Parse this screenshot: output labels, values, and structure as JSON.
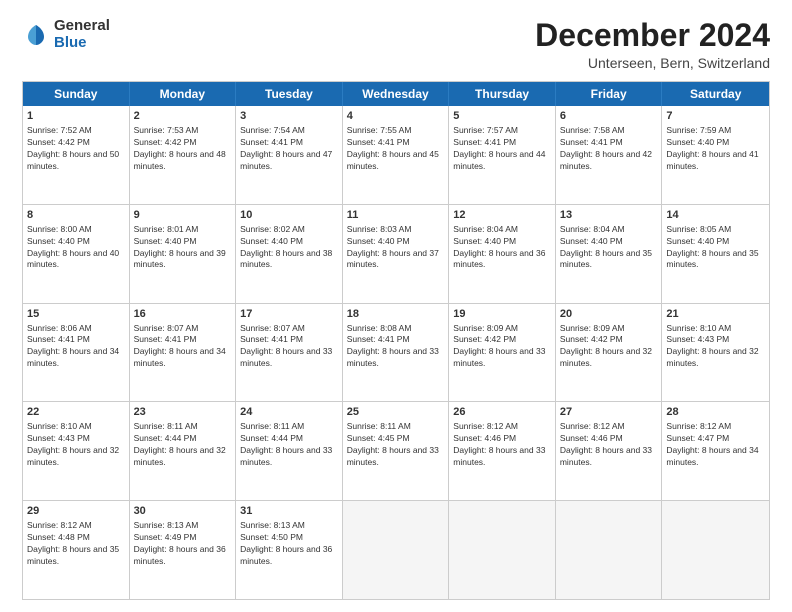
{
  "logo": {
    "general": "General",
    "blue": "Blue"
  },
  "title": "December 2024",
  "subtitle": "Unterseen, Bern, Switzerland",
  "days": [
    "Sunday",
    "Monday",
    "Tuesday",
    "Wednesday",
    "Thursday",
    "Friday",
    "Saturday"
  ],
  "weeks": [
    [
      {
        "day": "1",
        "sunrise": "Sunrise: 7:52 AM",
        "sunset": "Sunset: 4:42 PM",
        "daylight": "Daylight: 8 hours and 50 minutes."
      },
      {
        "day": "2",
        "sunrise": "Sunrise: 7:53 AM",
        "sunset": "Sunset: 4:42 PM",
        "daylight": "Daylight: 8 hours and 48 minutes."
      },
      {
        "day": "3",
        "sunrise": "Sunrise: 7:54 AM",
        "sunset": "Sunset: 4:41 PM",
        "daylight": "Daylight: 8 hours and 47 minutes."
      },
      {
        "day": "4",
        "sunrise": "Sunrise: 7:55 AM",
        "sunset": "Sunset: 4:41 PM",
        "daylight": "Daylight: 8 hours and 45 minutes."
      },
      {
        "day": "5",
        "sunrise": "Sunrise: 7:57 AM",
        "sunset": "Sunset: 4:41 PM",
        "daylight": "Daylight: 8 hours and 44 minutes."
      },
      {
        "day": "6",
        "sunrise": "Sunrise: 7:58 AM",
        "sunset": "Sunset: 4:41 PM",
        "daylight": "Daylight: 8 hours and 42 minutes."
      },
      {
        "day": "7",
        "sunrise": "Sunrise: 7:59 AM",
        "sunset": "Sunset: 4:40 PM",
        "daylight": "Daylight: 8 hours and 41 minutes."
      }
    ],
    [
      {
        "day": "8",
        "sunrise": "Sunrise: 8:00 AM",
        "sunset": "Sunset: 4:40 PM",
        "daylight": "Daylight: 8 hours and 40 minutes."
      },
      {
        "day": "9",
        "sunrise": "Sunrise: 8:01 AM",
        "sunset": "Sunset: 4:40 PM",
        "daylight": "Daylight: 8 hours and 39 minutes."
      },
      {
        "day": "10",
        "sunrise": "Sunrise: 8:02 AM",
        "sunset": "Sunset: 4:40 PM",
        "daylight": "Daylight: 8 hours and 38 minutes."
      },
      {
        "day": "11",
        "sunrise": "Sunrise: 8:03 AM",
        "sunset": "Sunset: 4:40 PM",
        "daylight": "Daylight: 8 hours and 37 minutes."
      },
      {
        "day": "12",
        "sunrise": "Sunrise: 8:04 AM",
        "sunset": "Sunset: 4:40 PM",
        "daylight": "Daylight: 8 hours and 36 minutes."
      },
      {
        "day": "13",
        "sunrise": "Sunrise: 8:04 AM",
        "sunset": "Sunset: 4:40 PM",
        "daylight": "Daylight: 8 hours and 35 minutes."
      },
      {
        "day": "14",
        "sunrise": "Sunrise: 8:05 AM",
        "sunset": "Sunset: 4:40 PM",
        "daylight": "Daylight: 8 hours and 35 minutes."
      }
    ],
    [
      {
        "day": "15",
        "sunrise": "Sunrise: 8:06 AM",
        "sunset": "Sunset: 4:41 PM",
        "daylight": "Daylight: 8 hours and 34 minutes."
      },
      {
        "day": "16",
        "sunrise": "Sunrise: 8:07 AM",
        "sunset": "Sunset: 4:41 PM",
        "daylight": "Daylight: 8 hours and 34 minutes."
      },
      {
        "day": "17",
        "sunrise": "Sunrise: 8:07 AM",
        "sunset": "Sunset: 4:41 PM",
        "daylight": "Daylight: 8 hours and 33 minutes."
      },
      {
        "day": "18",
        "sunrise": "Sunrise: 8:08 AM",
        "sunset": "Sunset: 4:41 PM",
        "daylight": "Daylight: 8 hours and 33 minutes."
      },
      {
        "day": "19",
        "sunrise": "Sunrise: 8:09 AM",
        "sunset": "Sunset: 4:42 PM",
        "daylight": "Daylight: 8 hours and 33 minutes."
      },
      {
        "day": "20",
        "sunrise": "Sunrise: 8:09 AM",
        "sunset": "Sunset: 4:42 PM",
        "daylight": "Daylight: 8 hours and 32 minutes."
      },
      {
        "day": "21",
        "sunrise": "Sunrise: 8:10 AM",
        "sunset": "Sunset: 4:43 PM",
        "daylight": "Daylight: 8 hours and 32 minutes."
      }
    ],
    [
      {
        "day": "22",
        "sunrise": "Sunrise: 8:10 AM",
        "sunset": "Sunset: 4:43 PM",
        "daylight": "Daylight: 8 hours and 32 minutes."
      },
      {
        "day": "23",
        "sunrise": "Sunrise: 8:11 AM",
        "sunset": "Sunset: 4:44 PM",
        "daylight": "Daylight: 8 hours and 32 minutes."
      },
      {
        "day": "24",
        "sunrise": "Sunrise: 8:11 AM",
        "sunset": "Sunset: 4:44 PM",
        "daylight": "Daylight: 8 hours and 33 minutes."
      },
      {
        "day": "25",
        "sunrise": "Sunrise: 8:11 AM",
        "sunset": "Sunset: 4:45 PM",
        "daylight": "Daylight: 8 hours and 33 minutes."
      },
      {
        "day": "26",
        "sunrise": "Sunrise: 8:12 AM",
        "sunset": "Sunset: 4:46 PM",
        "daylight": "Daylight: 8 hours and 33 minutes."
      },
      {
        "day": "27",
        "sunrise": "Sunrise: 8:12 AM",
        "sunset": "Sunset: 4:46 PM",
        "daylight": "Daylight: 8 hours and 33 minutes."
      },
      {
        "day": "28",
        "sunrise": "Sunrise: 8:12 AM",
        "sunset": "Sunset: 4:47 PM",
        "daylight": "Daylight: 8 hours and 34 minutes."
      }
    ],
    [
      {
        "day": "29",
        "sunrise": "Sunrise: 8:12 AM",
        "sunset": "Sunset: 4:48 PM",
        "daylight": "Daylight: 8 hours and 35 minutes."
      },
      {
        "day": "30",
        "sunrise": "Sunrise: 8:13 AM",
        "sunset": "Sunset: 4:49 PM",
        "daylight": "Daylight: 8 hours and 36 minutes."
      },
      {
        "day": "31",
        "sunrise": "Sunrise: 8:13 AM",
        "sunset": "Sunset: 4:50 PM",
        "daylight": "Daylight: 8 hours and 36 minutes."
      },
      null,
      null,
      null,
      null
    ]
  ]
}
